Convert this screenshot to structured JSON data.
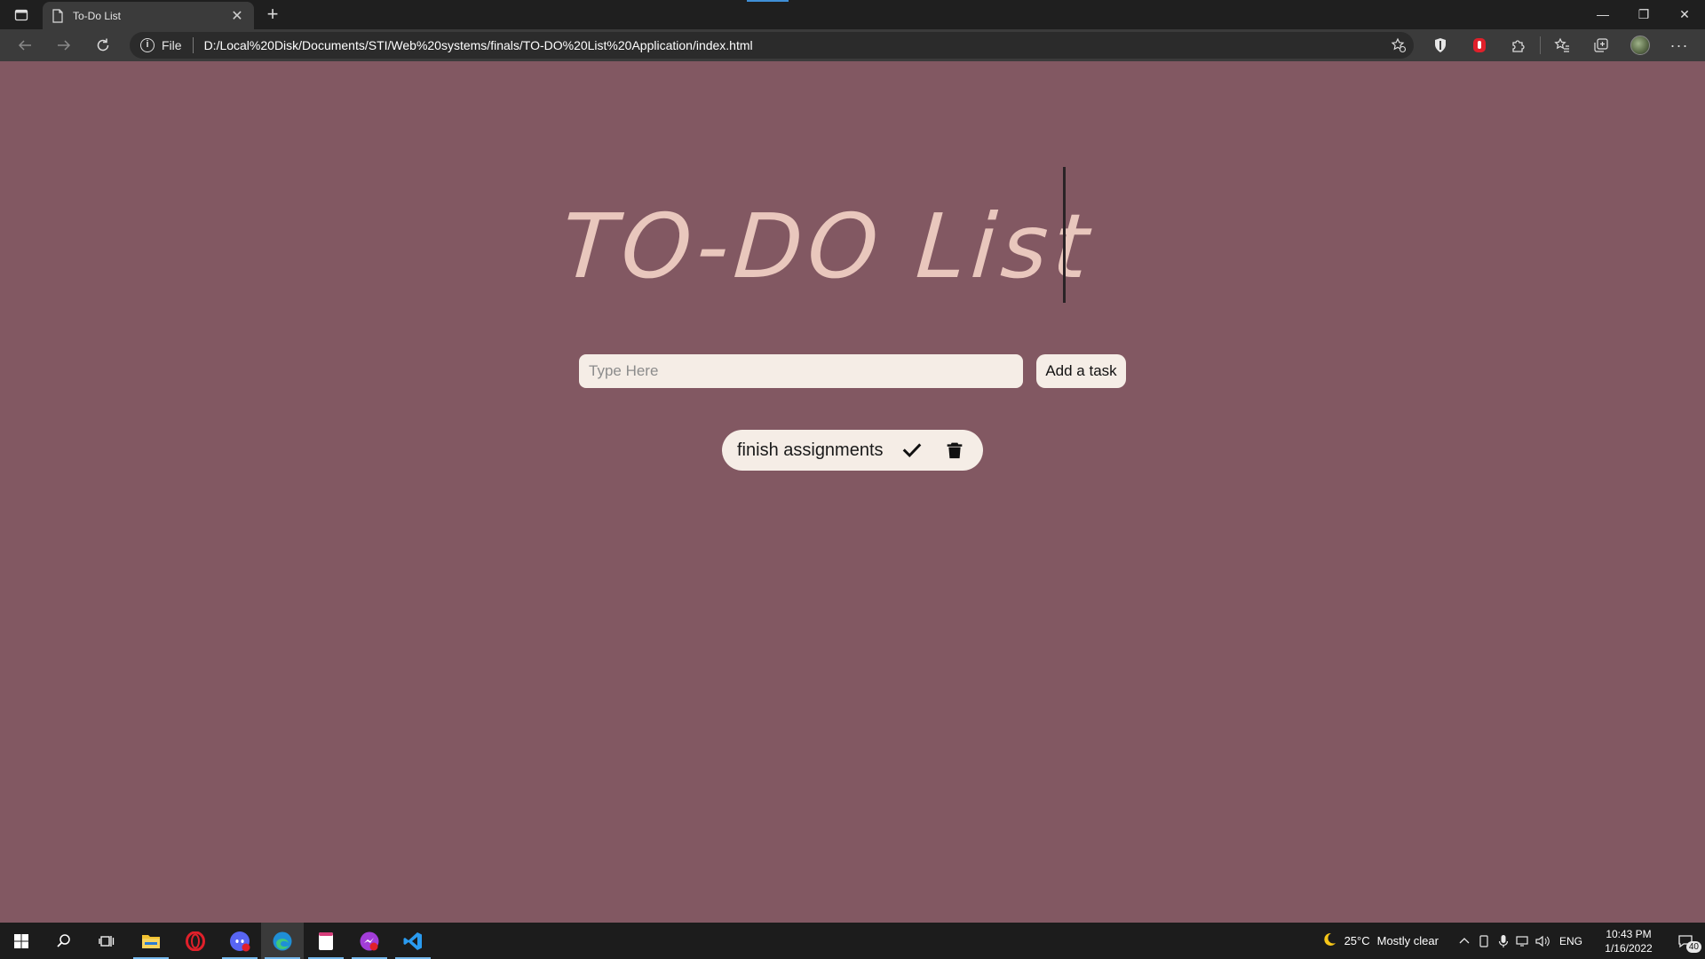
{
  "browser": {
    "tab": {
      "title": "To-Do List",
      "close_glyph": "✕"
    },
    "new_tab_glyph": "+",
    "window_controls": [
      "—",
      "❐",
      "✕"
    ],
    "address": {
      "scheme_label": "File",
      "url": "D:/Local%20Disk/Documents/STI/Web%20systems/finals/TO-DO%20List%20Application/index.html"
    },
    "toolbar_icons": [
      "favorites-add-icon",
      "shield-extension-icon",
      "red-extension-icon",
      "extensions-puzzle-icon",
      "favorites-icon",
      "collections-icon",
      "profile-avatar",
      "more-menu-icon"
    ],
    "more_glyph": "···"
  },
  "app": {
    "title": "TO-DO List",
    "input_placeholder": "Type Here",
    "input_value": "",
    "add_button_label": "Add a task",
    "tasks": [
      {
        "text": "finish assignments"
      }
    ],
    "colors": {
      "background": "#825862",
      "title": "#e9c7bd",
      "surface": "#f5ede6"
    }
  },
  "taskbar": {
    "apps": [
      "start-icon",
      "search-icon",
      "task-view-icon",
      "file-explorer-icon",
      "opera-icon",
      "discord-icon",
      "edge-icon",
      "notes-icon",
      "messenger-icon",
      "vscode-icon"
    ],
    "weather": {
      "temp": "25°C",
      "desc": "Mostly clear"
    },
    "language": "ENG",
    "clock": {
      "time": "10:43 PM",
      "date": "1/16/2022"
    },
    "notification_count": "40"
  }
}
